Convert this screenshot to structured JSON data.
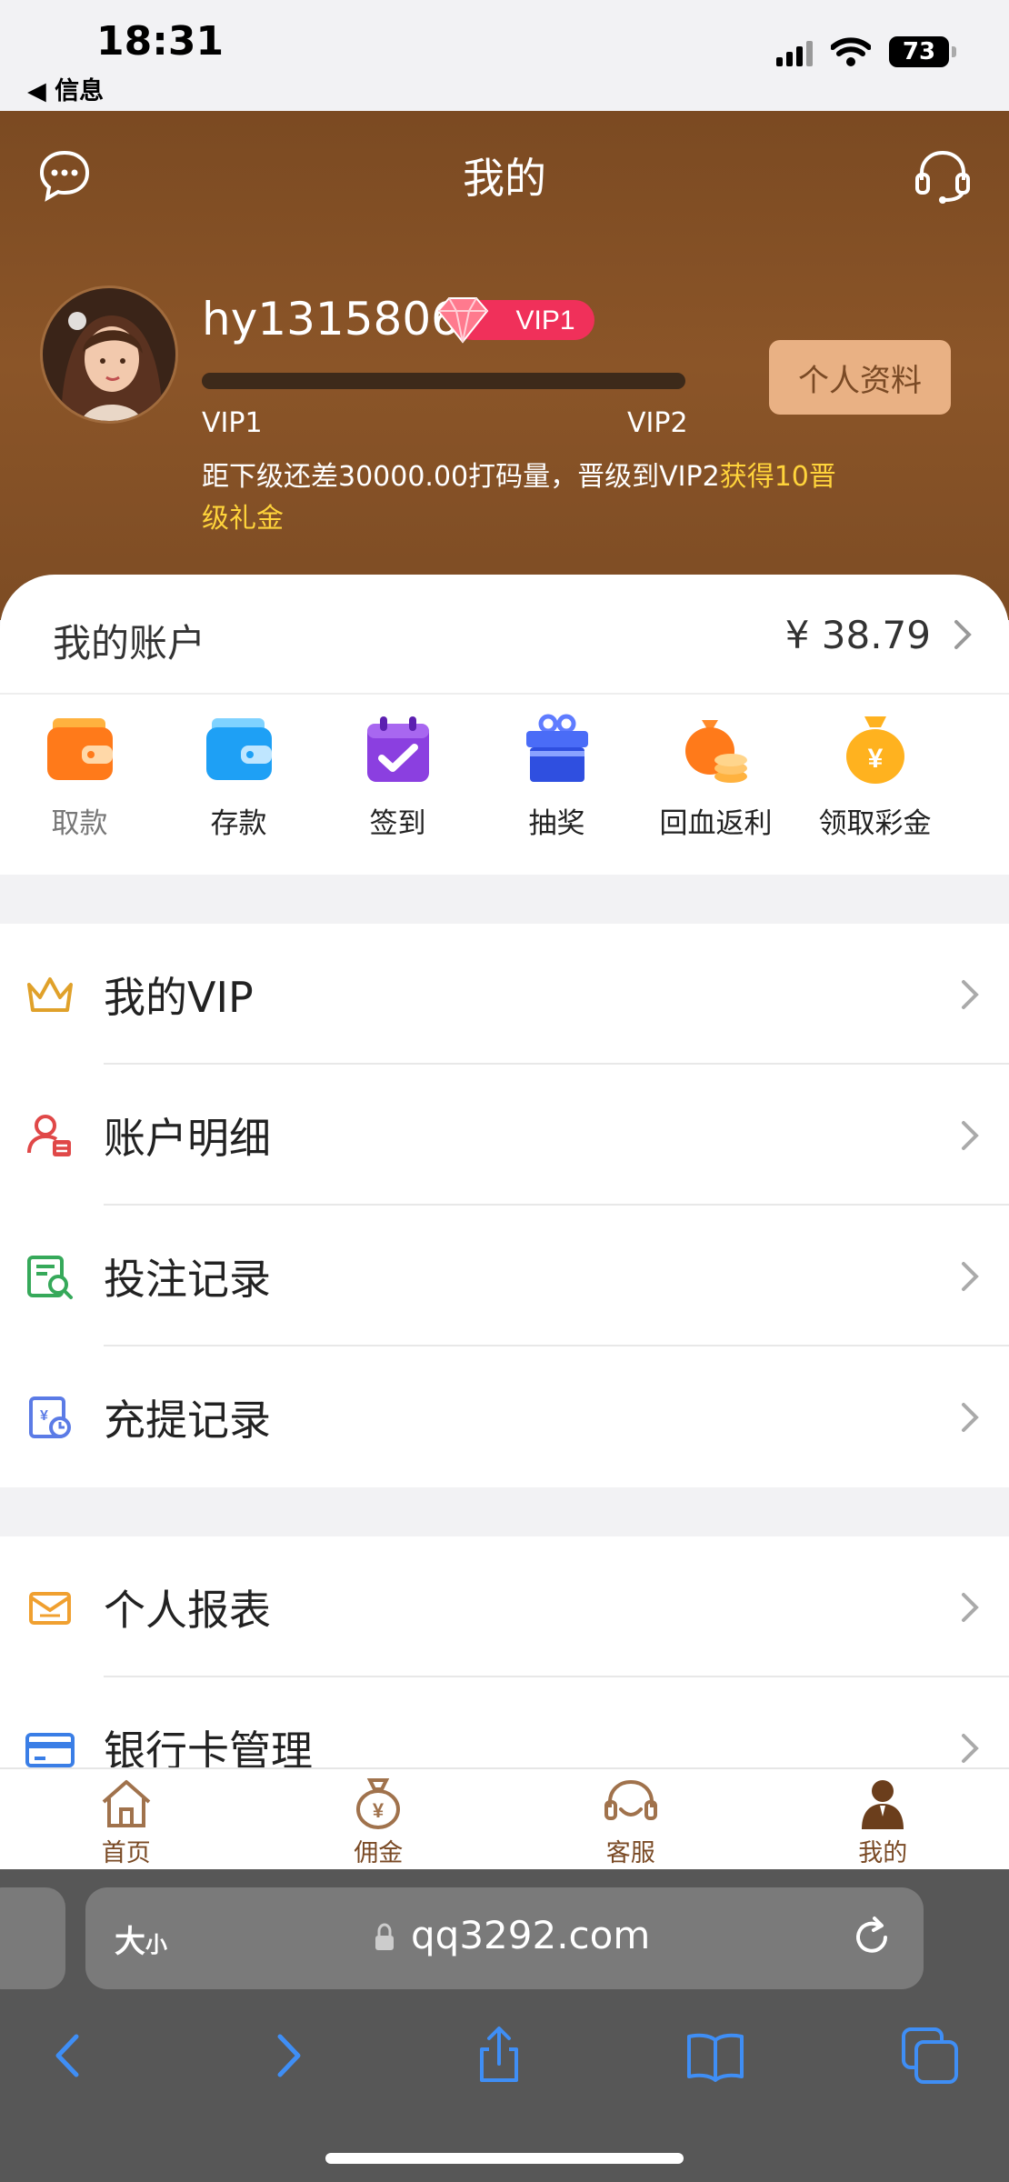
{
  "status_bar": {
    "time": "18:31",
    "back_label": "◀ 信息",
    "battery": "73"
  },
  "header": {
    "title": "我的",
    "username": "hy1315806",
    "vip_badge": "VIP1",
    "level_current": "VIP1",
    "level_next": "VIP2",
    "progress": 0,
    "profile_button": "个人资料",
    "upgrade_text": "距下级还差30000.00打码量，晋级到VIP2",
    "upgrade_reward": "获得10晋级礼金"
  },
  "account": {
    "label": "我的账户",
    "amount": "¥ 38.79"
  },
  "quick_actions": [
    {
      "label": "取款",
      "icon": "wallet-orange-icon"
    },
    {
      "label": "存款",
      "icon": "wallet-blue-icon"
    },
    {
      "label": "签到",
      "icon": "calendar-check-icon"
    },
    {
      "label": "抽奖",
      "icon": "gift-box-icon"
    },
    {
      "label": "回血返利",
      "icon": "money-bag-coins-icon"
    },
    {
      "label": "领取彩金",
      "icon": "money-bag-yuan-icon"
    }
  ],
  "menu_group_1": [
    {
      "label": "我的VIP",
      "icon": "crown-icon"
    },
    {
      "label": "账户明细",
      "icon": "user-ledger-icon"
    },
    {
      "label": "投注记录",
      "icon": "bet-record-icon"
    },
    {
      "label": "充提记录",
      "icon": "deposit-withdraw-icon"
    }
  ],
  "menu_group_2": [
    {
      "label": "个人报表",
      "icon": "report-icon"
    },
    {
      "label": "银行卡管理",
      "icon": "bank-card-icon"
    }
  ],
  "tabs": [
    {
      "label": "首页",
      "icon": "home-icon"
    },
    {
      "label": "佣金",
      "icon": "money-bag-icon"
    },
    {
      "label": "客服",
      "icon": "headset-icon"
    },
    {
      "label": "我的",
      "icon": "user-icon"
    }
  ],
  "safari": {
    "text_size_label": "大",
    "text_size_small": "小",
    "url": "qq3292.com"
  },
  "colors": {
    "header_brown": "#7b4a22",
    "accent_gold": "#ffd43b",
    "tab_brown": "#7a4a25"
  }
}
